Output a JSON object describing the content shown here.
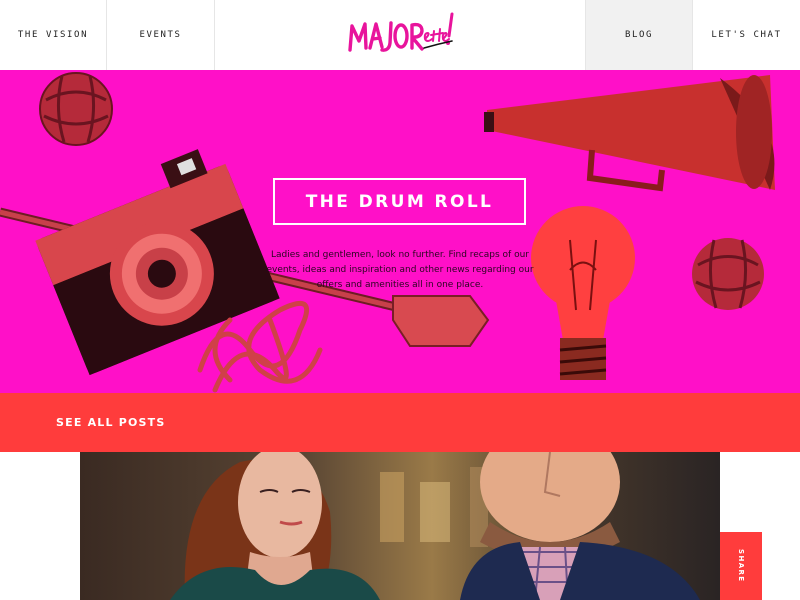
{
  "nav": {
    "vision": "THE VISION",
    "events": "EVENTS",
    "blog": "BLOG",
    "chat": "LET'S CHAT"
  },
  "logo": {
    "text": "MAJORette!",
    "icon": "majorette-logo"
  },
  "hero": {
    "title": "THE DRUM ROLL",
    "description": "Ladies and gentlemen, look no further. Find recaps of our events, ideas and inspiration and other news regarding our offers and amenities all in one place."
  },
  "posts_bar": {
    "label": "SEE ALL POSTS"
  },
  "share": {
    "label": "SHARE"
  },
  "colors": {
    "brand_pink": "#ff10c8",
    "accent_red": "#ff3c3c",
    "logo_pink": "#e8149c"
  }
}
